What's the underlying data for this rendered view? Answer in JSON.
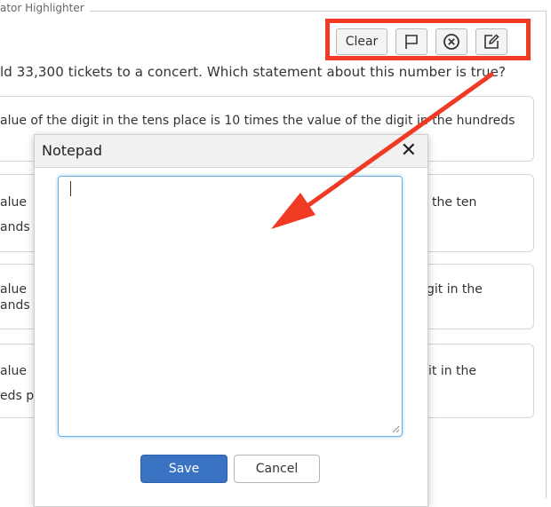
{
  "tool_panel_label": "ator   Highlighter",
  "toolbar": {
    "clear_label": "Clear",
    "icons": [
      "flag-icon",
      "cross-circle-icon",
      "edit-icon"
    ]
  },
  "question": "ld 33,300 tickets to a concert. Which statement about this number is true?",
  "options": [
    {
      "left_lines": [
        "alue of the digit in the tens place is 10 times the value of the digit in the hundreds"
      ],
      "right_lines": []
    },
    {
      "left_lines": [
        "alue",
        "ands"
      ],
      "right_lines": [
        "the ten"
      ]
    },
    {
      "left_lines": [
        "alue",
        "ands"
      ],
      "right_lines": [
        "git in the"
      ]
    },
    {
      "left_lines": [
        "alue",
        "eds p"
      ],
      "right_lines": [
        "it in the"
      ]
    }
  ],
  "notepad": {
    "title": "Notepad",
    "close_glyph": "✕",
    "text": "",
    "save_label": "Save",
    "cancel_label": "Cancel"
  },
  "annotation_color": "#f03a24"
}
